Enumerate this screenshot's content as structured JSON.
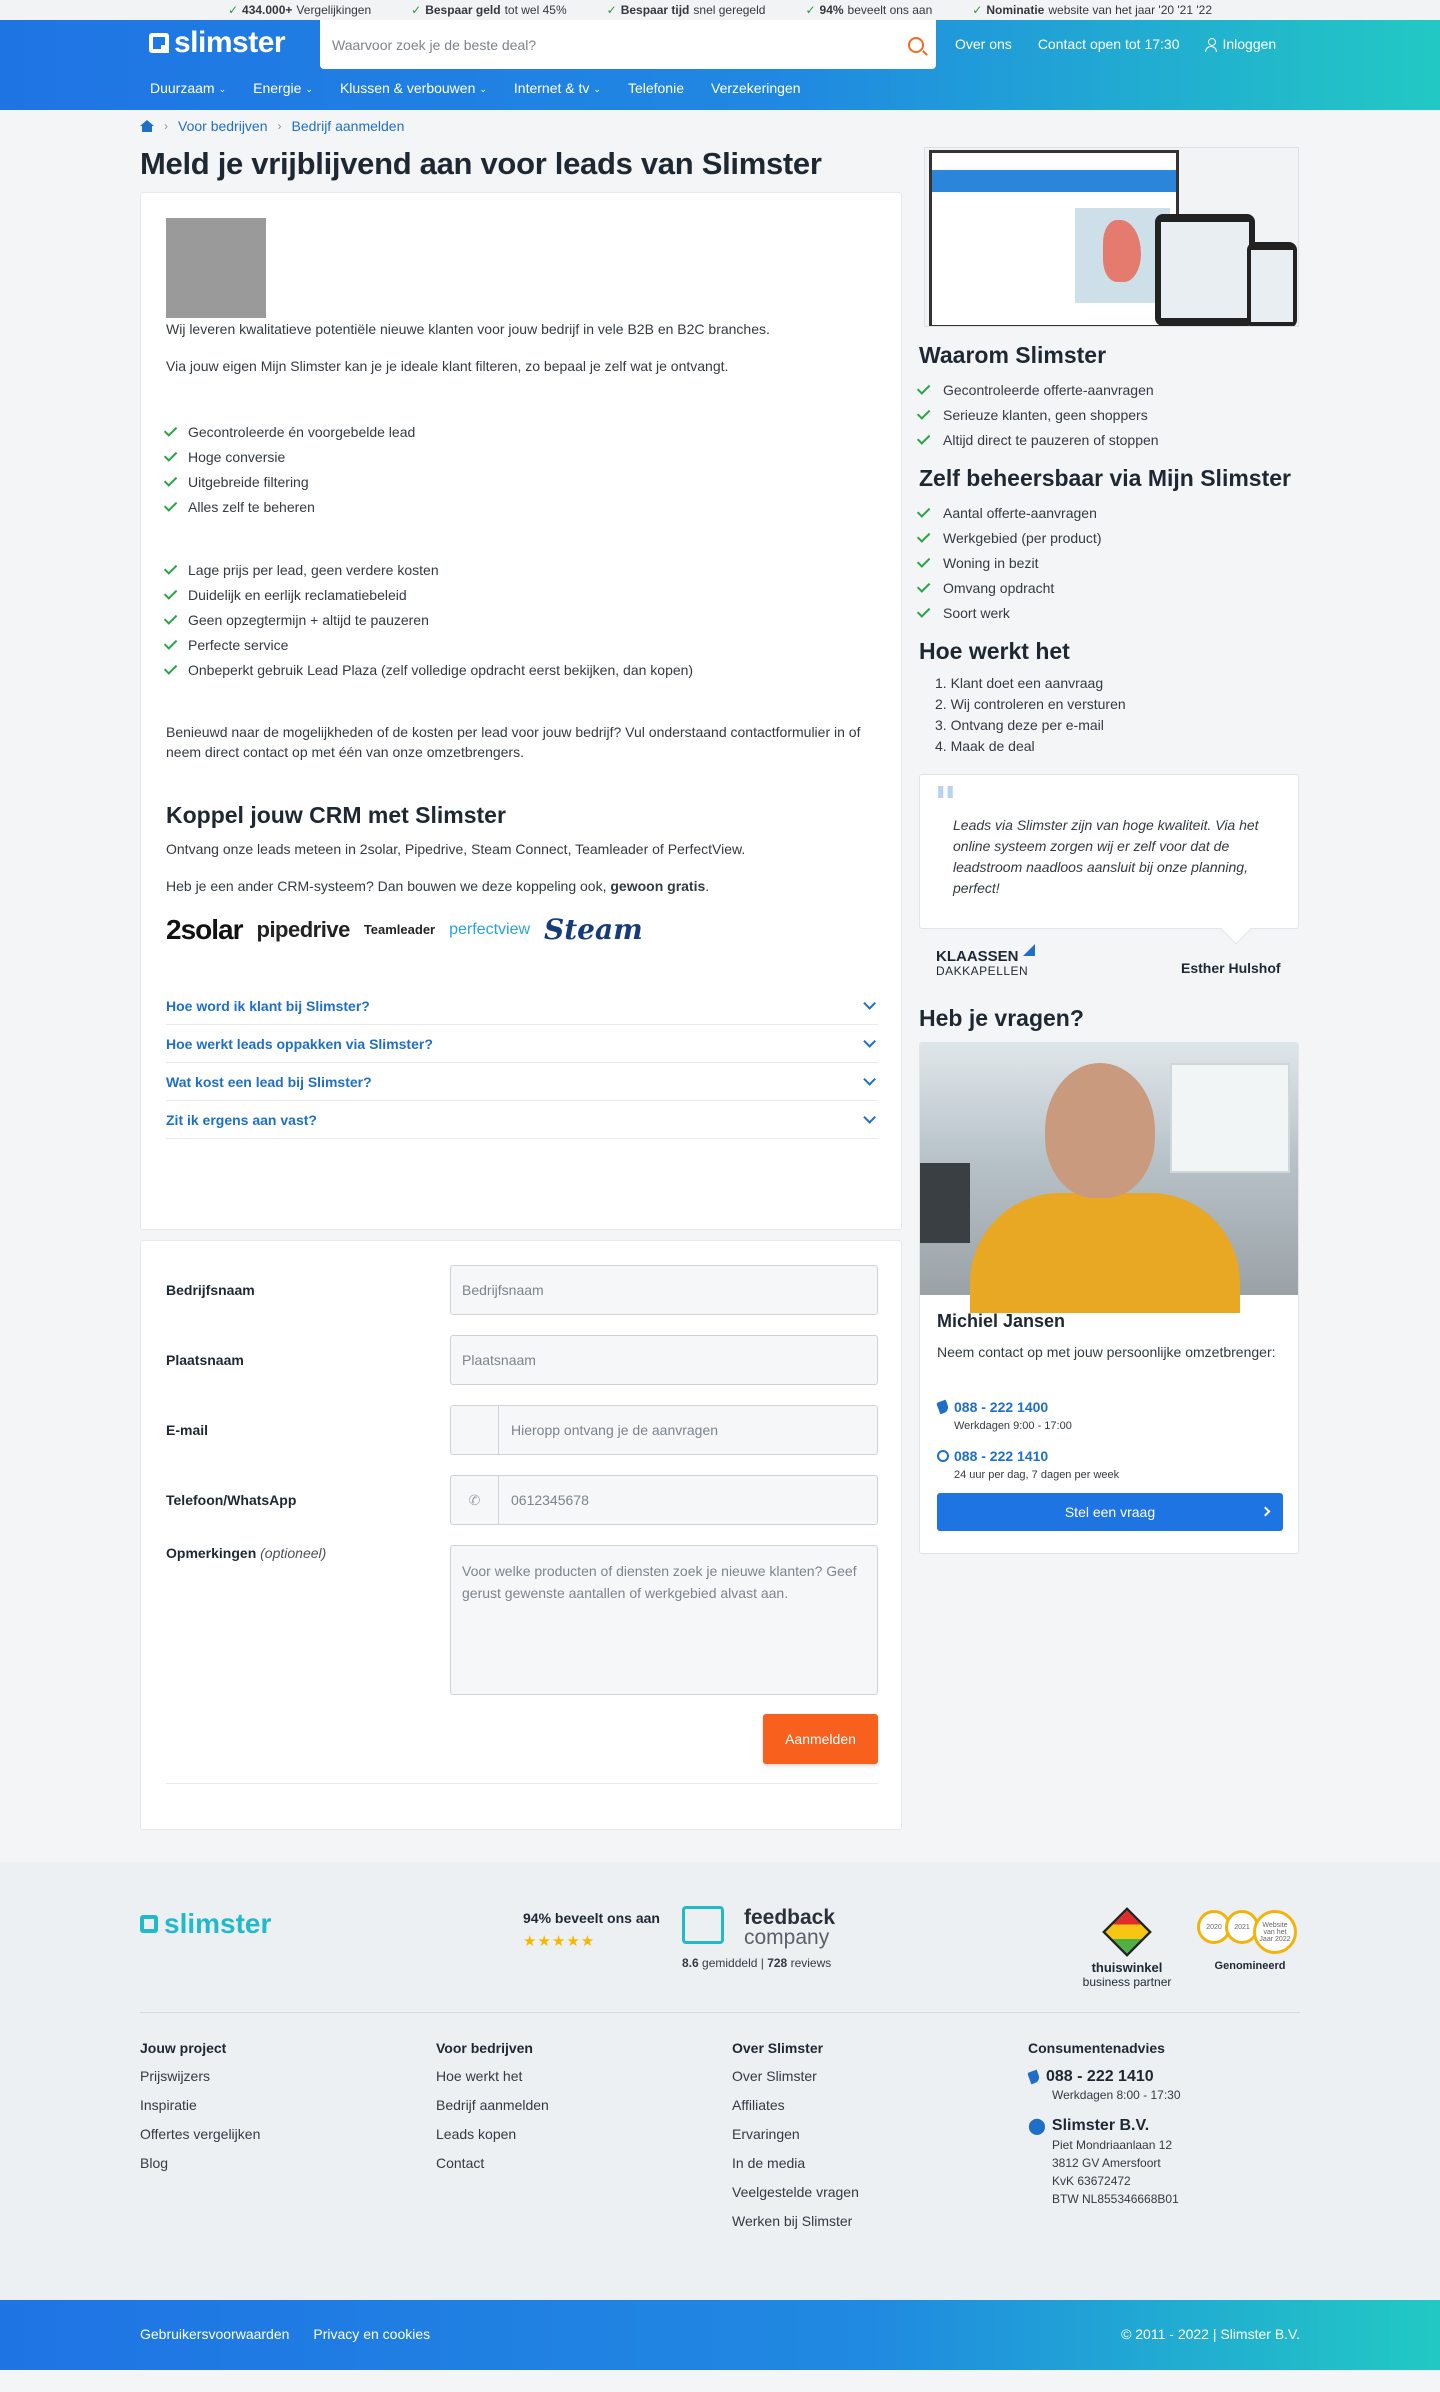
{
  "topbar": {
    "usps": [
      {
        "bold": "434.000+",
        "text": "Vergelijkingen"
      },
      {
        "bold": "Bespaar geld",
        "text": "tot wel 45%"
      },
      {
        "bold": "Bespaar tijd",
        "text": "snel geregeld"
      },
      {
        "bold": "94%",
        "text": "beveelt ons aan"
      },
      {
        "bold": "Nominatie",
        "text": "website van het jaar '20 '21 '22"
      }
    ]
  },
  "header": {
    "logo": "slimster",
    "search_placeholder": "Waarvoor zoek je de beste deal?",
    "about": "Over ons",
    "contact": "Contact open tot 17:30",
    "login": "Inloggen",
    "nav": [
      "Duurzaam",
      "Energie",
      "Klussen & verbouwen",
      "Internet & tv",
      "Telefonie",
      "Verzekeringen"
    ]
  },
  "breadcrumb": [
    "Voor bedrijven",
    "Bedrijf aanmelden"
  ],
  "page_title": "Meld je vrijblijvend aan voor leads van Slimster",
  "intro": {
    "p1": "Wij leveren kwalitatieve potentiële nieuwe klanten voor jouw bedrijf in vele B2B en B2C branches.",
    "p2": "Via jouw eigen Mijn Slimster kan je je ideale klant filteren, zo bepaal je zelf wat je ontvangt.",
    "list1": [
      "Gecontroleerde én voorgebelde lead",
      "Hoge conversie",
      "Uitgebreide filtering",
      "Alles zelf te beheren"
    ],
    "list2": [
      "Lage prijs per lead, geen verdere kosten",
      "Duidelijk en eerlijk reclamatiebeleid",
      "Geen opzegtermijn + altijd te pauzeren",
      "Perfecte service",
      "Onbeperkt gebruik Lead Plaza (zelf volledige opdracht eerst bekijken, dan kopen)"
    ],
    "p3": "Benieuwd naar de mogelijkheden of de kosten per lead voor jouw bedrijf? Vul onderstaand contactformulier in of neem direct contact op met één van onze omzetbrengers."
  },
  "crm": {
    "title": "Koppel jouw CRM met Slimster",
    "p1": "Ontvang onze leads meteen in 2solar, Pipedrive, Steam Connect, Teamleader of PerfectView.",
    "p2": "Heb je een ander CRM-systeem? Dan bouwen we deze koppeling ook,",
    "p2_bold": "gewoon gratis",
    "logos": [
      "2solar",
      "pipedrive",
      "Teamleader",
      "perfectview",
      "Steam"
    ]
  },
  "faq": [
    "Hoe word ik klant bij Slimster?",
    "Hoe werkt leads oppakken via Slimster?",
    "Wat kost een lead bij Slimster?",
    "Zit ik ergens aan vast?"
  ],
  "form": {
    "company_label": "Bedrijfsnaam",
    "company_ph": "Bedrijfsnaam",
    "city_label": "Plaatsnaam",
    "city_ph": "Plaatsnaam",
    "email_label": "E-mail",
    "email_ph": "Hieropp ontvang je de aanvragen",
    "phone_label": "Telefoon/WhatsApp",
    "phone_ph": "0612345678",
    "remarks_label": "Opmerkingen",
    "remarks_optional": "(optioneel)",
    "remarks_ph": "Voor welke producten of diensten zoek je nieuwe klanten? Geef gerust gewenste aantallen of werkgebied alvast aan.",
    "submit": "Aanmelden"
  },
  "sidebar": {
    "why_title": "Waarom Slimster",
    "why": [
      "Gecontroleerde offerte-aanvragen",
      "Serieuze klanten, geen shoppers",
      "Altijd direct te pauzeren of stoppen"
    ],
    "manage_title": "Zelf beheersbaar via Mijn Slimster",
    "manage": [
      "Aantal offerte-aanvragen",
      "Werkgebied (per product)",
      "Woning in bezit",
      "Omvang opdracht",
      "Soort werk"
    ],
    "how_title": "Hoe werkt het",
    "how": [
      "1. Klant doet een aanvraag",
      "2. Wij controleren en versturen",
      "3. Ontvang deze per e-mail",
      "4. Maak de deal"
    ],
    "quote": "Leads via Slimster zijn van hoge kwaliteit. Via het online systeem zorgen wij er zelf voor dat de leadstroom naadloos aansluit bij onze planning, perfect!",
    "quote_company": "KLAASSEN",
    "quote_company_sub": "DAKKAPELLEN",
    "quote_author": "Esther Hulshof",
    "questions_title": "Heb je vragen?",
    "contact_name": "Michiel Jansen",
    "contact_text": "Neem contact op met jouw persoonlijke omzetbrenger:",
    "phone1": "088 - 222 1400",
    "phone1_sub": "Werkdagen 9:00 - 17:00",
    "phone2": "088 - 222 1410",
    "phone2_sub": "24 uur per dag, 7 dagen per week",
    "ask_button": "Stel een vraag"
  },
  "footer": {
    "logo": "slimster",
    "recommend": "94% beveelt ons aan",
    "stars": "★★★★★",
    "fb_title1": "feedback",
    "fb_title2": "company",
    "fb_score": "8.6",
    "fb_score_label": "gemiddeld |",
    "fb_reviews": "728",
    "fb_reviews_label": "reviews",
    "tw1": "thuiswinkel",
    "tw2": "business partner",
    "nom": "Genomineerd",
    "seal_years": [
      "2020",
      "2021",
      "Website van het Jaar 2022"
    ],
    "col1_title": "Jouw project",
    "col1": [
      "Prijswijzers",
      "Inspiratie",
      "Offertes vergelijken",
      "Blog"
    ],
    "col2_title": "Voor bedrijven",
    "col2": [
      "Hoe werkt het",
      "Bedrijf aanmelden",
      "Leads kopen",
      "Contact"
    ],
    "col3_title": "Over Slimster",
    "col3": [
      "Over Slimster",
      "Affiliates",
      "Ervaringen",
      "In de media",
      "Veelgestelde vragen",
      "Werken bij Slimster"
    ],
    "col4_title": "Consumentenadvies",
    "phone": "088 - 222 1410",
    "phone_sub": "Werkdagen 8:00 - 17:30",
    "company": "Slimster B.V.",
    "address": [
      "Piet Mondriaanlaan 12",
      "3812 GV Amersfoort",
      "KvK 63672472",
      "BTW NL855346668B01"
    ],
    "terms": "Gebruikersvoorwaarden",
    "privacy": "Privacy en cookies",
    "copyright": "© 2011 - 2022 | Slimster B.V."
  }
}
